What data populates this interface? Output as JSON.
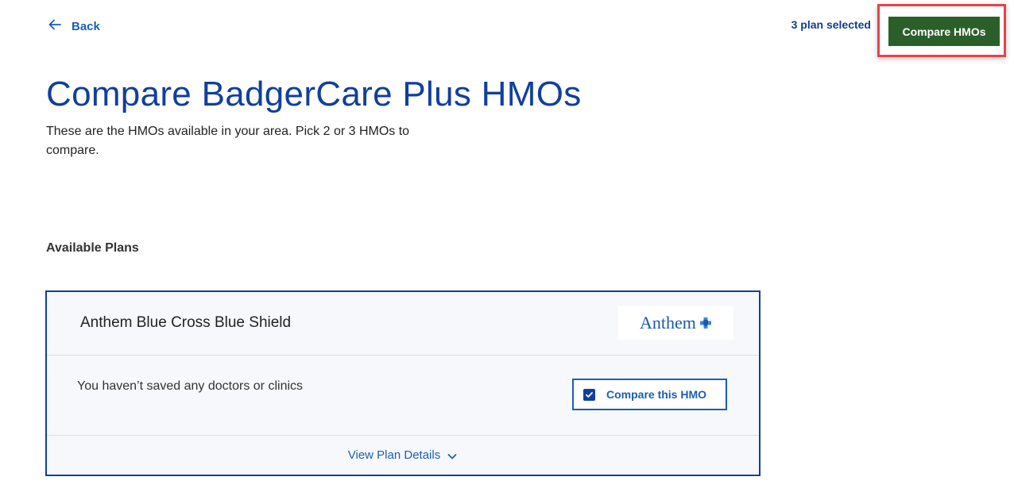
{
  "header": {
    "back_label": "Back",
    "plan_count": "3 plan selected",
    "compare_button_label": "Compare HMOs"
  },
  "page": {
    "title": "Compare BadgerCare Plus HMOs",
    "subtitle": "These are the HMOs available in your area. Pick 2 or 3 HMOs to compare."
  },
  "plans_section": {
    "heading": "Available Plans",
    "plans": [
      {
        "name": "Anthem Blue Cross Blue Shield",
        "logo_text": "Anthem",
        "doctors_text": "You haven’t saved any doctors or clinics",
        "compare_label": "Compare this HMO",
        "compare_checked": true,
        "details_label": "View Plan Details"
      }
    ]
  },
  "colors": {
    "brand_blue": "#103f9e",
    "link_blue": "#1a5fb4",
    "compare_button_green": "#2b5f2a",
    "highlight_red": "#e8424b"
  },
  "icons": {
    "back": "arrow-left-icon",
    "checkbox": "checkmark-icon",
    "details": "chevron-down-icon",
    "logo": "blue-cross-shield-icon"
  }
}
